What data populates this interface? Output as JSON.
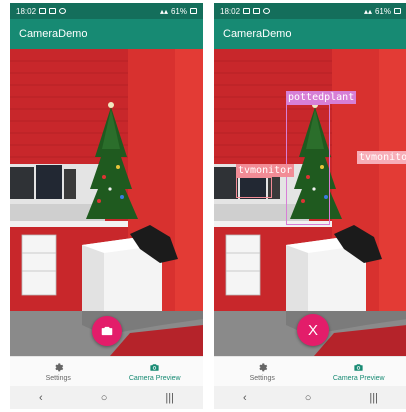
{
  "screens": [
    {
      "status": {
        "time": "18:02",
        "battery": "61%"
      },
      "app_title": "CameraDemo",
      "fab": {
        "kind": "capture"
      },
      "nav": {
        "settings_label": "Settings",
        "camera_label": "Camera Preview",
        "active": "camera"
      },
      "detections": []
    },
    {
      "status": {
        "time": "18:02",
        "battery": "61%"
      },
      "app_title": "CameraDemo",
      "fab": {
        "kind": "close",
        "label": "X"
      },
      "nav": {
        "settings_label": "Settings",
        "camera_label": "Camera Preview",
        "active": "camera"
      },
      "detections": [
        {
          "label": "pottedplant",
          "color": "#d77fd6"
        },
        {
          "label": "tvmonitor",
          "color": "#f28c96"
        },
        {
          "label": "tvmonito",
          "color": "#f7aeb8"
        }
      ]
    }
  ],
  "colors": {
    "statusbar": "#146e5b",
    "appbar": "#178a73",
    "fab": "#e31d6a",
    "nav_active": "#178a73"
  },
  "icons": {
    "capture": "camera-icon",
    "close": "close-icon",
    "settings": "gear-icon",
    "camera_nav": "camera-icon"
  }
}
